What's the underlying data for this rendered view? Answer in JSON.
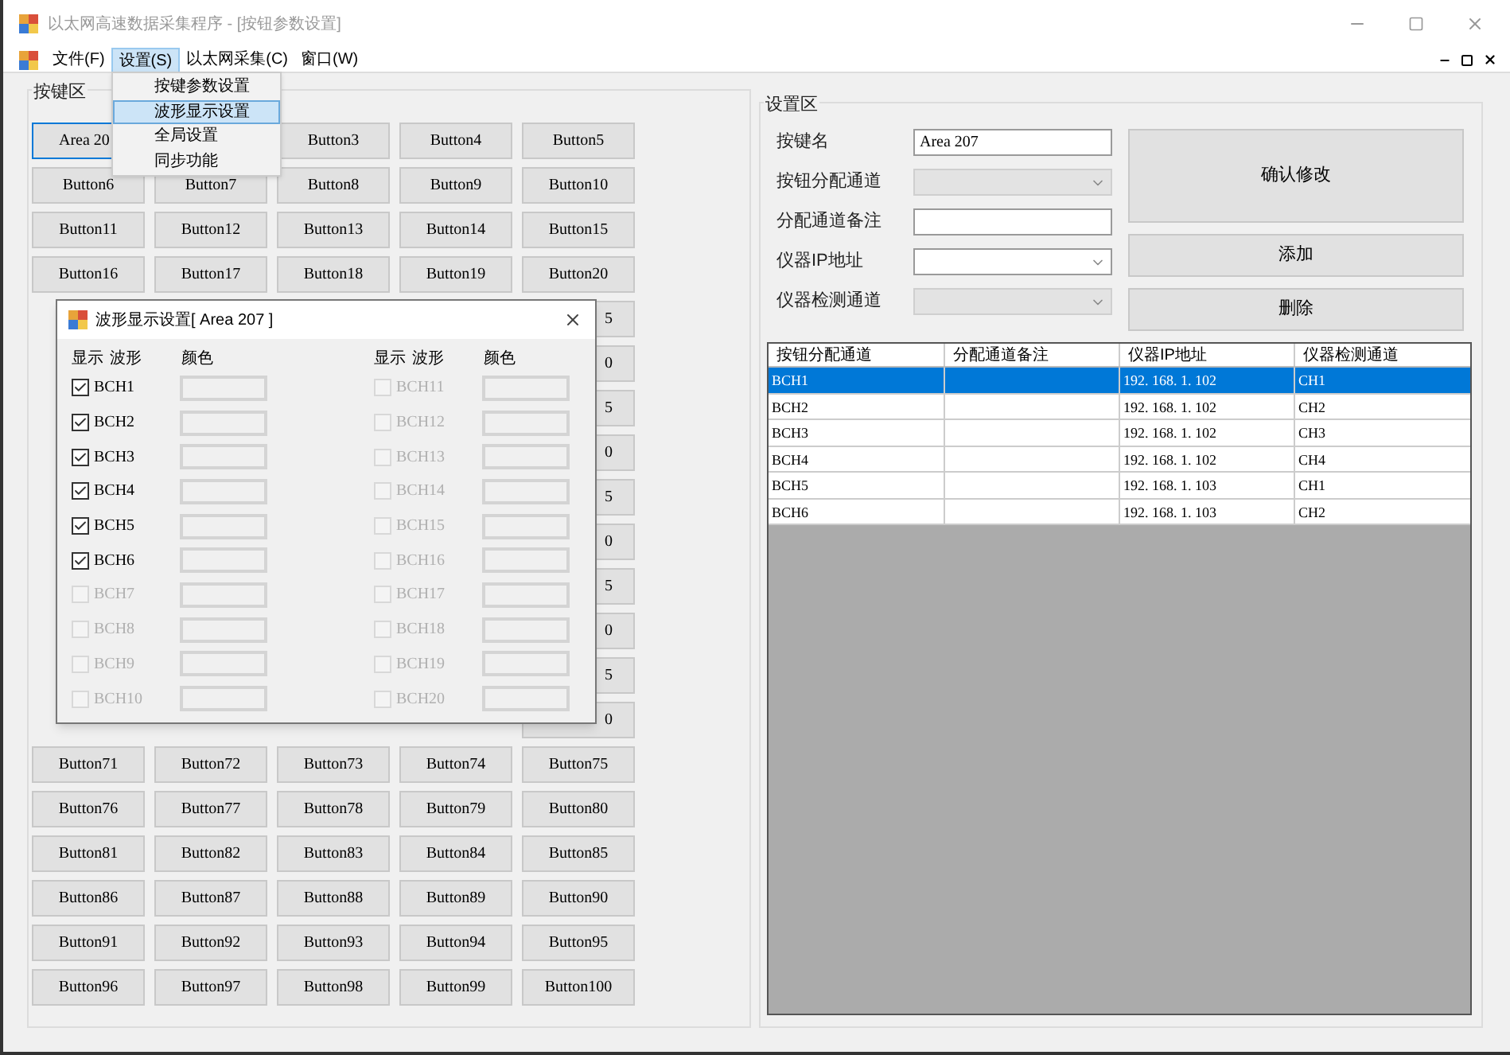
{
  "window": {
    "title": "以太网高速数据采集程序 - [按钮参数设置]"
  },
  "menu_bar": [
    {
      "label": "文件(F)",
      "selected": false
    },
    {
      "label": "设置(S)",
      "selected": true
    },
    {
      "label": "以太网采集(C)",
      "selected": false
    },
    {
      "label": "窗口(W)",
      "selected": false
    }
  ],
  "dropdown_menu": [
    {
      "label": "按键参数设置",
      "selected": false
    },
    {
      "label": "波形显示设置",
      "selected": true
    },
    {
      "label": "全局设置",
      "selected": false
    },
    {
      "label": "同步功能",
      "selected": false
    }
  ],
  "button_area": {
    "title": "按键区",
    "rows": [
      {
        "cells": [
          {
            "label": "Area 20",
            "kind": "clipped_right",
            "selected": true
          },
          null,
          {
            "label": "Button3",
            "selected": false
          },
          {
            "label": "Button4",
            "selected": false
          },
          {
            "label": "Button5",
            "selected": false
          }
        ]
      },
      {
        "cells": [
          {
            "label": "Button6",
            "selected": false
          },
          {
            "label": "Button7",
            "selected": false
          },
          {
            "label": "Button8",
            "selected": false
          },
          {
            "label": "Button9",
            "selected": false
          },
          {
            "label": "Button10",
            "selected": false
          }
        ]
      },
      {
        "cells": [
          {
            "label": "Button11",
            "selected": false
          },
          {
            "label": "Button12",
            "selected": false
          },
          {
            "label": "Button13",
            "selected": false
          },
          {
            "label": "Button14",
            "selected": false
          },
          {
            "label": "Button15",
            "selected": false
          }
        ]
      },
      {
        "cells": [
          {
            "label": "Button16",
            "selected": false
          },
          {
            "label": "Button17",
            "selected": false
          },
          {
            "label": "Button18",
            "selected": false
          },
          {
            "label": "Button19",
            "selected": false
          },
          {
            "label": "Button20",
            "selected": false
          }
        ]
      },
      {
        "cells": [
          null,
          null,
          null,
          null,
          {
            "label": "5",
            "kind": "clipped_left",
            "selected": false
          }
        ]
      },
      {
        "cells": [
          null,
          null,
          null,
          null,
          {
            "label": "0",
            "kind": "clipped_left",
            "selected": false
          }
        ]
      },
      {
        "cells": [
          null,
          null,
          null,
          null,
          {
            "label": "5",
            "kind": "clipped_left",
            "selected": false
          }
        ]
      },
      {
        "cells": [
          null,
          null,
          null,
          null,
          {
            "label": "0",
            "kind": "clipped_left",
            "selected": false
          }
        ]
      },
      {
        "cells": [
          null,
          null,
          null,
          null,
          {
            "label": "5",
            "kind": "clipped_left",
            "selected": false
          }
        ]
      },
      {
        "cells": [
          null,
          null,
          null,
          null,
          {
            "label": "0",
            "kind": "clipped_left",
            "selected": false
          }
        ]
      },
      {
        "cells": [
          null,
          null,
          null,
          null,
          {
            "label": "5",
            "kind": "clipped_left",
            "selected": false
          }
        ]
      },
      {
        "cells": [
          null,
          null,
          null,
          null,
          {
            "label": "0",
            "kind": "clipped_left",
            "selected": false
          }
        ]
      },
      {
        "cells": [
          null,
          null,
          null,
          null,
          {
            "label": "5",
            "kind": "clipped_left",
            "selected": false
          }
        ]
      },
      {
        "cells": [
          null,
          null,
          null,
          null,
          {
            "label": "0",
            "kind": "clipped_left",
            "selected": false
          }
        ]
      },
      {
        "cells": [
          {
            "label": "Button71",
            "selected": false
          },
          {
            "label": "Button72",
            "selected": false
          },
          {
            "label": "Button73",
            "selected": false
          },
          {
            "label": "Button74",
            "selected": false
          },
          {
            "label": "Button75",
            "selected": false
          }
        ]
      },
      {
        "cells": [
          {
            "label": "Button76",
            "selected": false
          },
          {
            "label": "Button77",
            "selected": false
          },
          {
            "label": "Button78",
            "selected": false
          },
          {
            "label": "Button79",
            "selected": false
          },
          {
            "label": "Button80",
            "selected": false
          }
        ]
      },
      {
        "cells": [
          {
            "label": "Button81",
            "selected": false
          },
          {
            "label": "Button82",
            "selected": false
          },
          {
            "label": "Button83",
            "selected": false
          },
          {
            "label": "Button84",
            "selected": false
          },
          {
            "label": "Button85",
            "selected": false
          }
        ]
      },
      {
        "cells": [
          {
            "label": "Button86",
            "selected": false
          },
          {
            "label": "Button87",
            "selected": false
          },
          {
            "label": "Button88",
            "selected": false
          },
          {
            "label": "Button89",
            "selected": false
          },
          {
            "label": "Button90",
            "selected": false
          }
        ]
      },
      {
        "cells": [
          {
            "label": "Button91",
            "selected": false
          },
          {
            "label": "Button92",
            "selected": false
          },
          {
            "label": "Button93",
            "selected": false
          },
          {
            "label": "Button94",
            "selected": false
          },
          {
            "label": "Button95",
            "selected": false
          }
        ]
      },
      {
        "cells": [
          {
            "label": "Button96",
            "selected": false
          },
          {
            "label": "Button97",
            "selected": false
          },
          {
            "label": "Button98",
            "selected": false
          },
          {
            "label": "Button99",
            "selected": false
          },
          {
            "label": "Button100",
            "selected": false
          }
        ]
      }
    ]
  },
  "settings_area": {
    "title": "设置区",
    "fields": [
      {
        "label": "按键名",
        "kind": "text",
        "value": "Area 207",
        "disabled": false
      },
      {
        "label": "按钮分配通道",
        "kind": "select",
        "disabled": true
      },
      {
        "label": "分配通道备注",
        "kind": "text",
        "disabled": false
      },
      {
        "label": "仪器IP地址",
        "kind": "select",
        "disabled": false
      },
      {
        "label": "仪器检测通道",
        "kind": "select",
        "disabled": true
      }
    ],
    "buttons": [
      "确认修改",
      "添加",
      "删除"
    ],
    "table": {
      "columns": [
        "按钮分配通道",
        "分配通道备注",
        "仪器IP地址",
        "仪器检测通道"
      ],
      "rows": [
        {
          "cells": [
            "BCH1",
            "",
            "192. 168. 1. 102",
            "CH1"
          ],
          "selected": true
        },
        {
          "cells": [
            "BCH2",
            "",
            "192. 168. 1. 102",
            "CH2"
          ],
          "selected": false
        },
        {
          "cells": [
            "BCH3",
            "",
            "192. 168. 1. 102",
            "CH3"
          ],
          "selected": false
        },
        {
          "cells": [
            "BCH4",
            "",
            "192. 168. 1. 102",
            "CH4"
          ],
          "selected": false
        },
        {
          "cells": [
            "BCH5",
            "",
            "192. 168. 1. 103",
            "CH1"
          ],
          "selected": false
        },
        {
          "cells": [
            "BCH6",
            "",
            "192. 168. 1. 103",
            "CH2"
          ],
          "selected": false
        }
      ]
    }
  },
  "dialog": {
    "title": "波形显示设置[ Area 207 ]",
    "columns": [
      {
        "headers": [
          "显示",
          "波形",
          "颜色"
        ],
        "channels": [
          {
            "label": "BCH1",
            "checked": true,
            "disabled": false
          },
          {
            "label": "BCH2",
            "checked": true,
            "disabled": false
          },
          {
            "label": "BCH3",
            "checked": true,
            "disabled": false
          },
          {
            "label": "BCH4",
            "checked": true,
            "disabled": false
          },
          {
            "label": "BCH5",
            "checked": true,
            "disabled": false
          },
          {
            "label": "BCH6",
            "checked": true,
            "disabled": false
          },
          {
            "label": "BCH7",
            "checked": false,
            "disabled": true
          },
          {
            "label": "BCH8",
            "checked": false,
            "disabled": true
          },
          {
            "label": "BCH9",
            "checked": false,
            "disabled": true
          },
          {
            "label": "BCH10",
            "checked": false,
            "disabled": true
          }
        ]
      },
      {
        "headers": [
          "显示",
          "波形",
          "颜色"
        ],
        "channels": [
          {
            "label": "BCH11",
            "checked": false,
            "disabled": true
          },
          {
            "label": "BCH12",
            "checked": false,
            "disabled": true
          },
          {
            "label": "BCH13",
            "checked": false,
            "disabled": true
          },
          {
            "label": "BCH14",
            "checked": false,
            "disabled": true
          },
          {
            "label": "BCH15",
            "checked": false,
            "disabled": true
          },
          {
            "label": "BCH16",
            "checked": false,
            "disabled": true
          },
          {
            "label": "BCH17",
            "checked": false,
            "disabled": true
          },
          {
            "label": "BCH18",
            "checked": false,
            "disabled": true
          },
          {
            "label": "BCH19",
            "checked": false,
            "disabled": true
          },
          {
            "label": "BCH20",
            "checked": false,
            "disabled": true
          }
        ]
      }
    ]
  }
}
